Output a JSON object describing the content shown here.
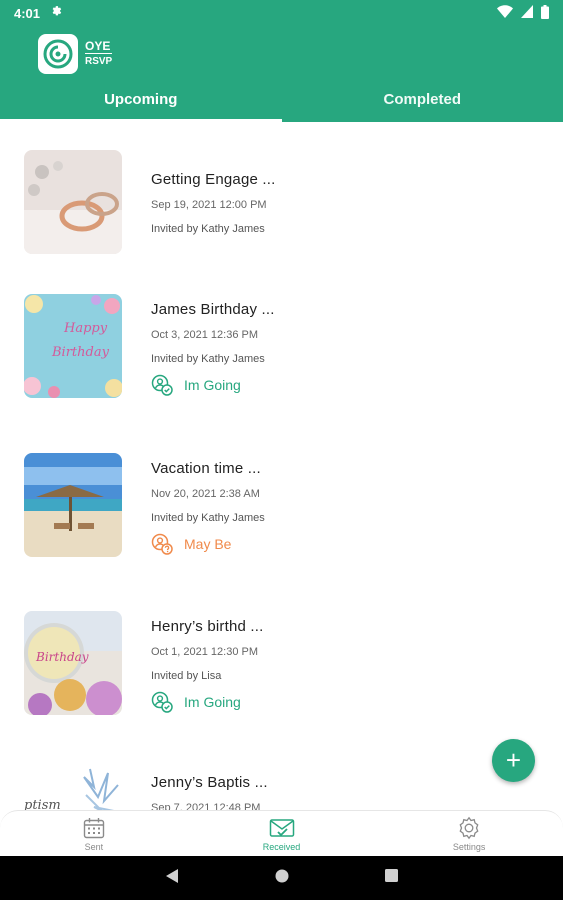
{
  "status": {
    "time": "4:01"
  },
  "logo": {
    "line1": "OYE",
    "line2": "RSVP"
  },
  "tabs": [
    {
      "label": "Upcoming",
      "active": true
    },
    {
      "label": "Completed",
      "active": false
    }
  ],
  "events": [
    {
      "title": "Getting Engage ...",
      "datetime": "Sep 19, 2021 12:00 PM",
      "invited_by": "Invited by Kathy James",
      "rsvp": ""
    },
    {
      "title": "James Birthday ...",
      "datetime": "Oct 3, 2021 12:36 PM",
      "invited_by": "Invited by Kathy James",
      "rsvp": "Im Going"
    },
    {
      "title": "Vacation time  ...",
      "datetime": "Nov 20, 2021 2:38 AM",
      "invited_by": "Invited by Kathy James",
      "rsvp": "May Be"
    },
    {
      "title": "Henry’s birthd ...",
      "datetime": "Oct 1, 2021 12:30 PM",
      "invited_by": "Invited by Lisa",
      "rsvp": "Im Going"
    },
    {
      "title": "Jenny’s Baptis ...",
      "datetime": "Sep 7, 2021 12:48 PM",
      "invited_by": "",
      "rsvp": ""
    }
  ],
  "fab": {
    "symbol": "+"
  },
  "bottom_nav": [
    {
      "label": "Sent",
      "icon": "calendar-icon",
      "active": false
    },
    {
      "label": "Received",
      "icon": "envelope-check-icon",
      "active": true
    },
    {
      "label": "Settings",
      "icon": "gear-icon",
      "active": false
    }
  ],
  "colors": {
    "primary": "#27a77f",
    "maybe": "#f08a4b"
  }
}
